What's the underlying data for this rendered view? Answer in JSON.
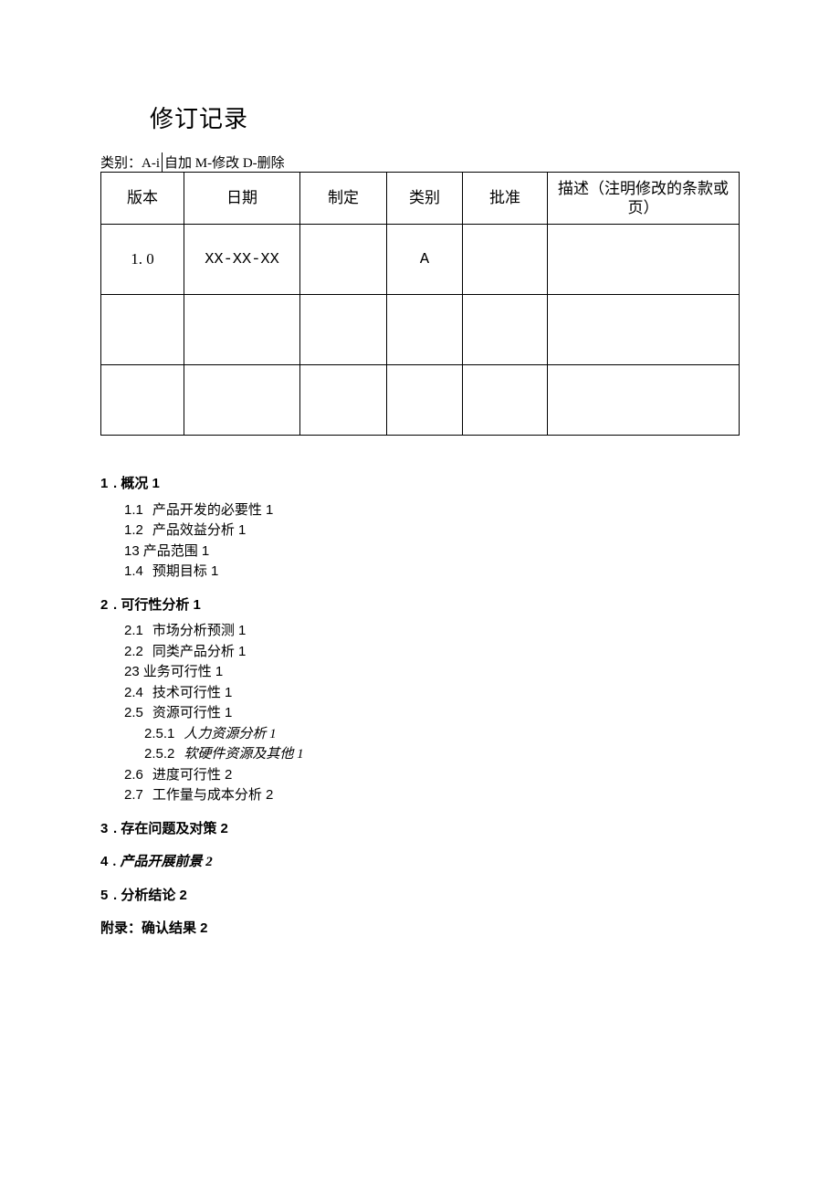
{
  "title": "修订记录",
  "legend": {
    "prefix": "类别：A-i",
    "rest": "自加 M-修改 D-删除"
  },
  "table": {
    "headers": {
      "version": "版本",
      "date": "日期",
      "maker": "制定",
      "category": "类别",
      "approval": "批准",
      "desc_line1": "描述（注明修改的条款或",
      "desc_line2": "页）"
    },
    "rows": [
      {
        "version": "1. 0",
        "date": "XX-XX-XX",
        "maker": "",
        "category": "A",
        "approval": "",
        "desc": ""
      },
      {
        "version": "",
        "date": "",
        "maker": "",
        "category": "",
        "approval": "",
        "desc": ""
      },
      {
        "version": "",
        "date": "",
        "maker": "",
        "category": "",
        "approval": "",
        "desc": ""
      }
    ]
  },
  "toc": [
    {
      "level": 1,
      "num": "1",
      "text": ". 概况 1"
    },
    {
      "level": 2,
      "num": "1.1",
      "text": "产品开发的必要性 1"
    },
    {
      "level": 2,
      "num": "1.2",
      "text": "产品效益分析 1"
    },
    {
      "level": 2,
      "num": "13",
      "text": "产品范围 1",
      "tight": true
    },
    {
      "level": 2,
      "num": "1.4",
      "text": "预期目标 1"
    },
    {
      "level": 1,
      "num": "2",
      "text": ". 可行性分析 1"
    },
    {
      "level": 2,
      "num": "2.1",
      "text": "市场分析预测 1"
    },
    {
      "level": 2,
      "num": "2.2",
      "text": "同类产品分析 1"
    },
    {
      "level": 2,
      "num": "23",
      "text": "业务可行性 1",
      "tight": true
    },
    {
      "level": 2,
      "num": "2.4",
      "text": "技术可行性 1"
    },
    {
      "level": 2,
      "num": "2.5",
      "text": "资源可行性 1"
    },
    {
      "level": 3,
      "num": "2.5.1",
      "text": "人力资源分析 1"
    },
    {
      "level": 3,
      "num": "2.5.2",
      "text": "软硬件资源及其他 1"
    },
    {
      "level": 2,
      "num": "2.6",
      "text": "进度可行性 2"
    },
    {
      "level": 2,
      "num": "2.7",
      "text": "工作量与成本分析 2"
    },
    {
      "level": 1,
      "num": "3",
      "text": ". 存在问题及对策 2"
    },
    {
      "level": 1,
      "num": "4",
      "text": ". 产品开展前景 2",
      "italic": true
    },
    {
      "level": 1,
      "num": "5",
      "text": ". 分析结论 2"
    },
    {
      "level": 1,
      "num": "",
      "text": "附录：确认结果 2",
      "appendix": true
    }
  ]
}
